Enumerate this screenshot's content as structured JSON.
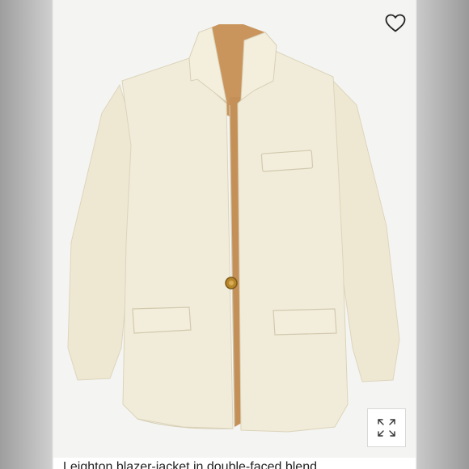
{
  "product": {
    "image_alt": "Cream wool blazer with tan contrast lining and a single gold button",
    "caption": "Leighton blazer-jacket in double-faced blend"
  },
  "icons": {
    "favorite": "heart-outline-icon",
    "expand": "expand-arrows-icon"
  },
  "colors": {
    "jacket": "#f1ecd9",
    "lining": "#c9955c",
    "button": "#b8862a",
    "background": "#f4f4f2"
  }
}
